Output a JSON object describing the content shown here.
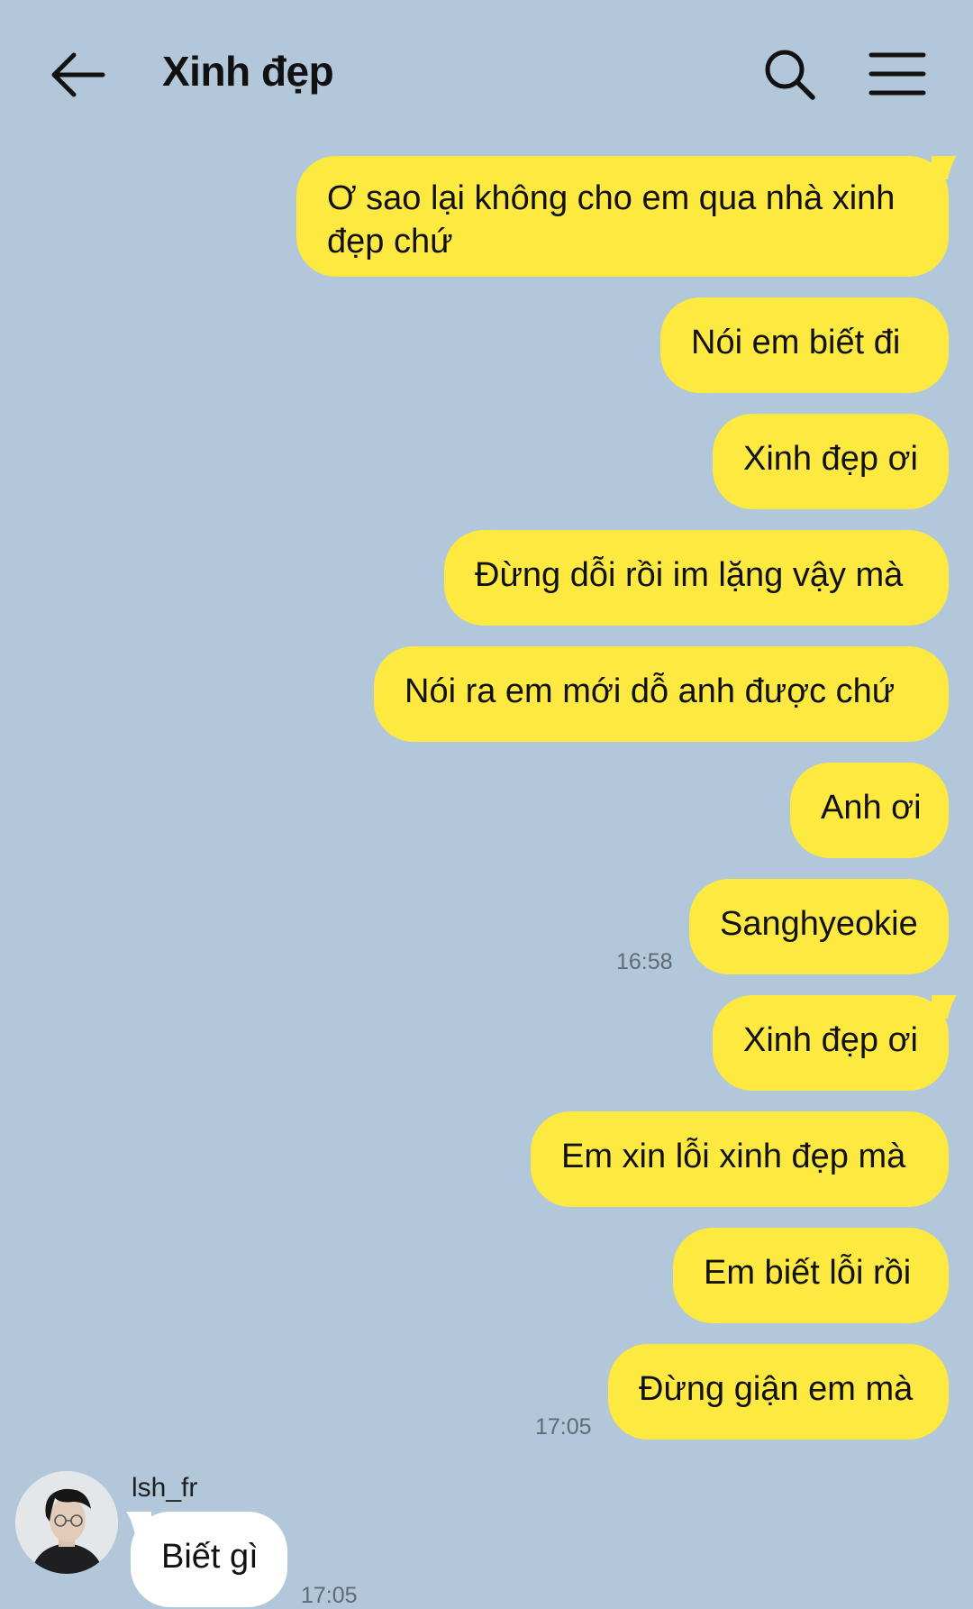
{
  "header": {
    "title": "Xinh đẹp"
  },
  "messages": {
    "m1": "Ơ sao lại không cho em qua nhà xinh đẹp chứ",
    "m2": "Nói em biết đi",
    "m3": "Xinh đẹp ơi",
    "m4": "Đừng dỗi rồi im lặng vậy mà",
    "m5": "Nói ra em mới dỗ anh được chứ",
    "m6": "Anh ơi",
    "m7": "Sanghyeokie",
    "t1": "16:58",
    "m8": "Xinh đẹp ơi",
    "m9": "Em xin lỗi xinh đẹp mà",
    "m10": "Em biết lỗi rồi",
    "m11": "Đừng giận em mà",
    "t2": "17:05"
  },
  "incoming": {
    "sender": "lsh_fr",
    "text": "Biết gì",
    "time": "17:05"
  },
  "icons": {
    "back": "arrow-left-icon",
    "search": "search-icon",
    "menu": "hamburger-menu-icon"
  },
  "colors": {
    "background": "#b2c7da",
    "outgoing_bubble": "#fde93f",
    "incoming_bubble": "#ffffff"
  }
}
